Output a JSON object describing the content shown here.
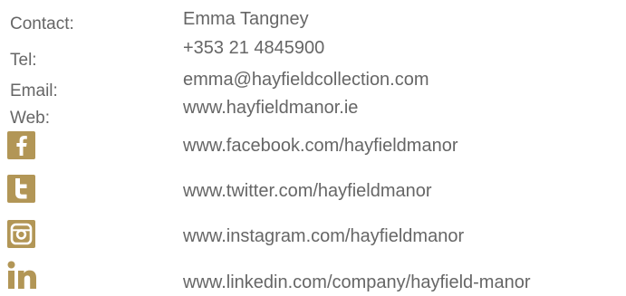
{
  "contact_info": {
    "labels": {
      "contact": "Contact:",
      "tel": "Tel:",
      "email": "Email:",
      "web": "Web:"
    },
    "name": "Emma Tangney",
    "tel": "+353 21 4845900",
    "email": "emma@hayfieldcollection.com",
    "web": "www.hayfieldmanor.ie"
  },
  "social": [
    {
      "icon": "facebook-icon",
      "url": "www.facebook.com/hayfieldmanor"
    },
    {
      "icon": "twitter-icon",
      "url": "www.twitter.com/hayfieldmanor"
    },
    {
      "icon": "instagram-icon",
      "url": "www.instagram.com/hayfieldmanor"
    },
    {
      "icon": "linkedin-icon",
      "url": "www.linkedin.com/company/hayfield-manor"
    }
  ],
  "colors": {
    "text": "#666666",
    "icon_gold": "#b29656"
  }
}
